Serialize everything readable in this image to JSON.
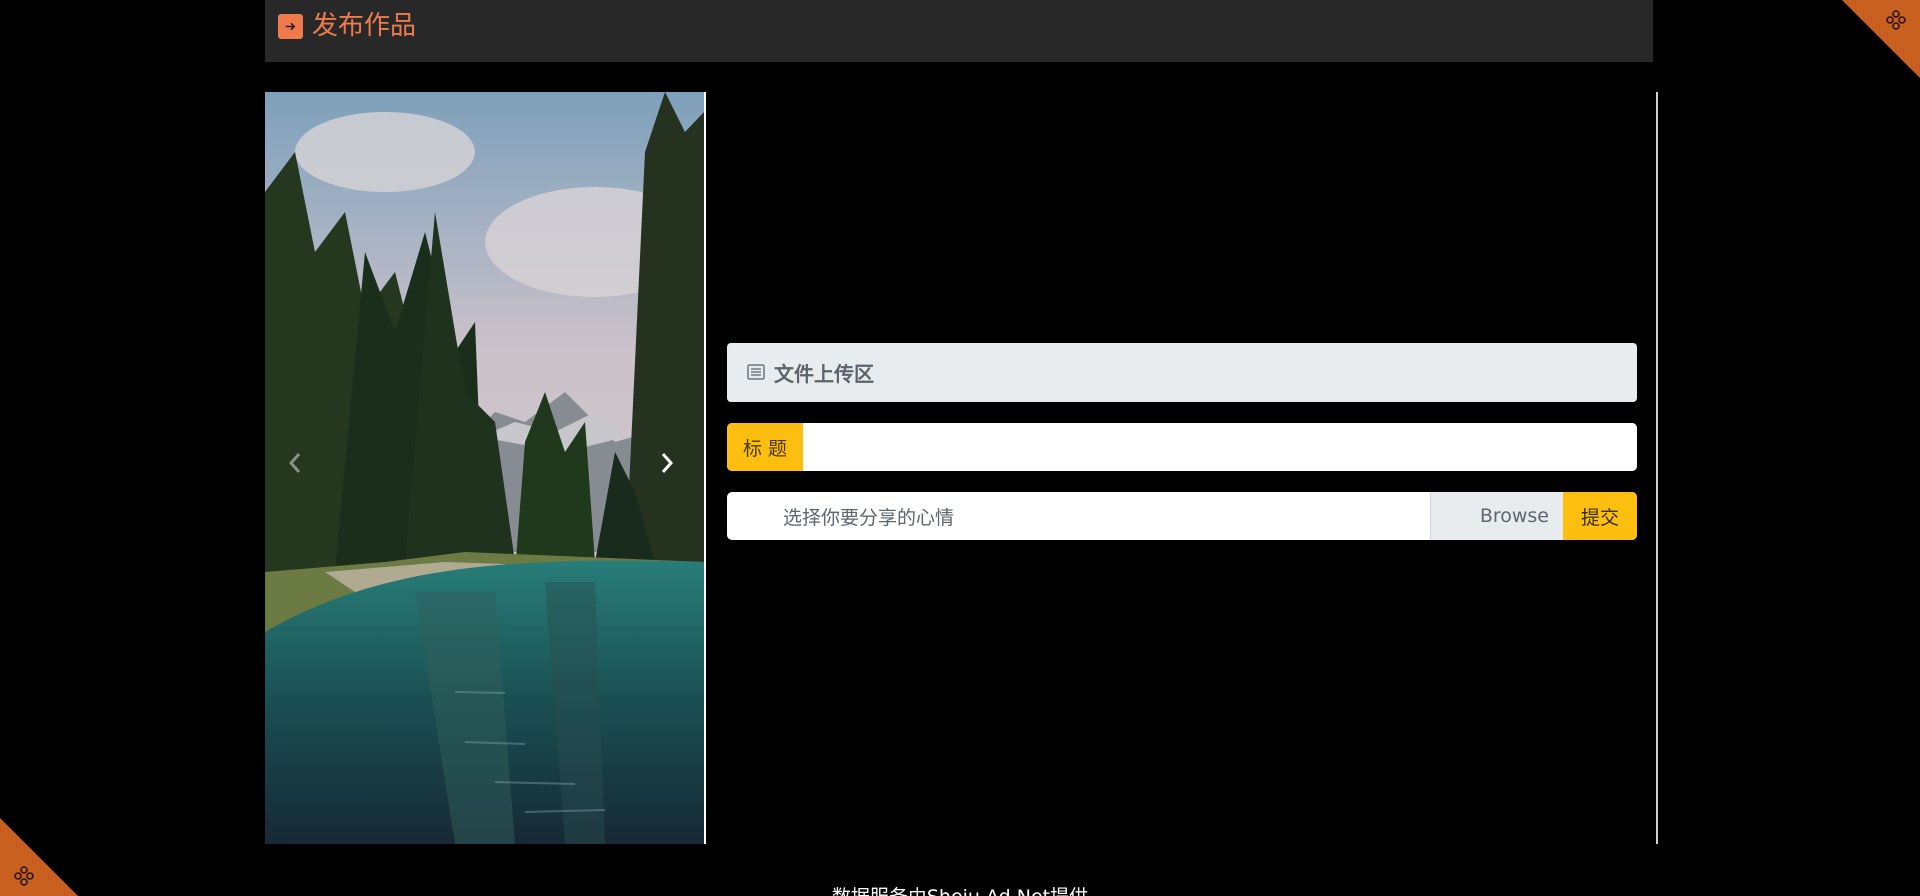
{
  "header": {
    "title": "发布作品"
  },
  "carousel": {
    "prev": "previous",
    "next": "next"
  },
  "upload": {
    "section_title": "文件上传区",
    "title_label": "标 题",
    "title_value": "",
    "file_placeholder": "选择你要分享的心情",
    "browse_label": "Browse",
    "submit_label": "提交"
  },
  "footer": {
    "text": "数据服务由Sheju.Ad.Net提供"
  },
  "colors": {
    "accent": "#ef7b4d",
    "corner": "#c9601f",
    "button": "#fcbe0f",
    "header_bg": "#282828",
    "panel_bg": "#e9ecef"
  },
  "icons": {
    "header": "arrow-right-square-icon",
    "corners": "four-circles-icon",
    "section": "document-lines-icon",
    "carousel_prev": "chevron-left-icon",
    "carousel_next": "chevron-right-icon"
  }
}
